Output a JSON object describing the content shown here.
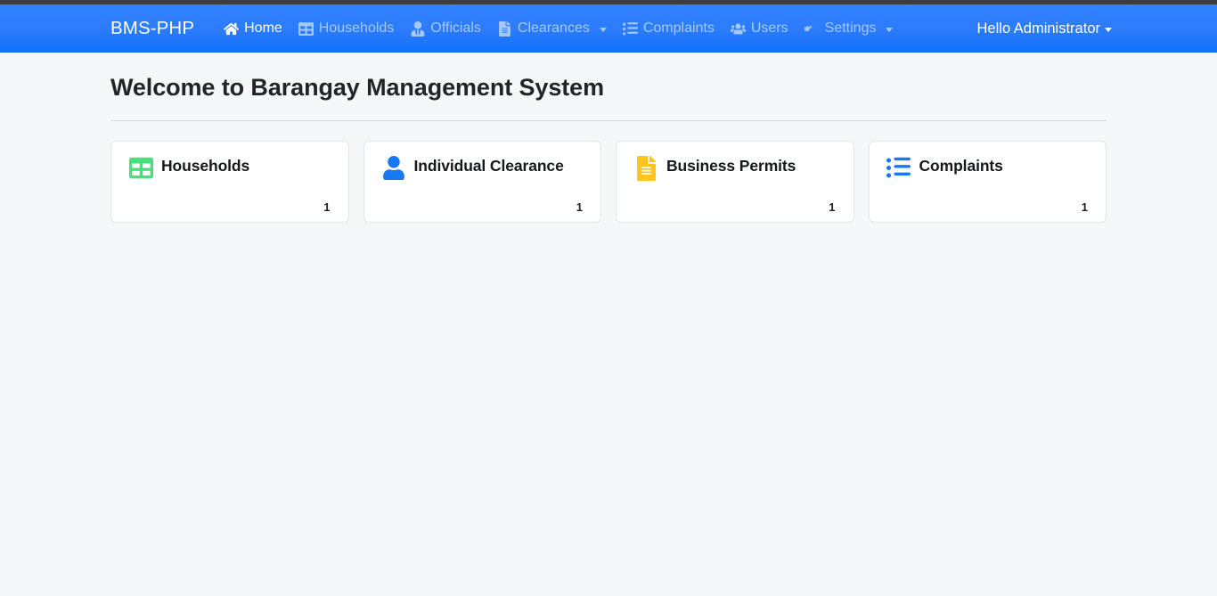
{
  "navbar": {
    "brand": "BMS-PHP",
    "items": [
      {
        "label": "Home",
        "icon": "home-icon",
        "active": true,
        "caret": false
      },
      {
        "label": "Households",
        "icon": "table-icon",
        "active": false,
        "caret": false
      },
      {
        "label": "Officials",
        "icon": "user-tie-icon",
        "active": false,
        "caret": false
      },
      {
        "label": "Clearances",
        "icon": "file-alt-icon",
        "active": false,
        "caret": true
      },
      {
        "label": "Complaints",
        "icon": "list-ul-icon",
        "active": false,
        "caret": false
      },
      {
        "label": "Users",
        "icon": "users-icon",
        "active": false,
        "caret": false
      },
      {
        "label": "Settings",
        "icon": "cogs-icon",
        "active": false,
        "caret": true
      }
    ],
    "user_menu": "Hello Administrator"
  },
  "main": {
    "page_title": "Welcome to Barangay Management System",
    "cards": [
      {
        "label": "Households",
        "count": "1",
        "icon": "table-icon",
        "color": "#4ade80"
      },
      {
        "label": "Individual Clearance",
        "count": "1",
        "icon": "user-icon",
        "color": "#1877f2"
      },
      {
        "label": "Business Permits",
        "count": "1",
        "icon": "file-alt-icon",
        "color": "#ffc51f"
      },
      {
        "label": "Complaints",
        "count": "1",
        "icon": "list-ul-icon",
        "color": "#1877f2"
      }
    ]
  },
  "colors": {
    "navbar_blue": "#2b7bfb",
    "page_background": "#f6f7f9",
    "card_background": "#ffffff",
    "card_border": "#e3e5e9",
    "divider": "#d8dade",
    "text_primary": "#212529",
    "nav_inactive": "rgba(255,255,255,0.58)"
  }
}
